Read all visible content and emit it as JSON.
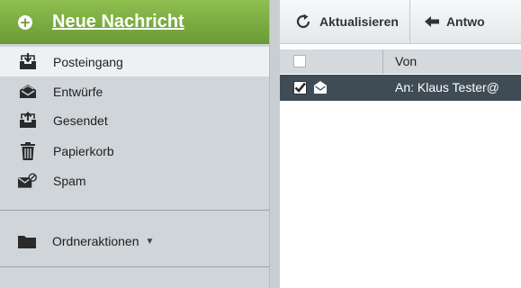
{
  "sidebar": {
    "new_message": "Neue Nachricht",
    "folders": [
      {
        "label": "Posteingang",
        "icon": "inbox-icon",
        "active": true
      },
      {
        "label": "Entwürfe",
        "icon": "drafts-icon"
      },
      {
        "label": "Gesendet",
        "icon": "sent-icon"
      },
      {
        "label": "Papierkorb",
        "icon": "trash-icon"
      },
      {
        "label": "Spam",
        "icon": "spam-icon"
      }
    ],
    "folder_actions": "Ordneraktionen"
  },
  "toolbar": {
    "refresh": "Aktualisieren",
    "reply": "Antwo"
  },
  "message_list": {
    "columns": {
      "from": "Von"
    },
    "rows": [
      {
        "to": "An: Klaus Tester@",
        "checked": true,
        "selected": true
      }
    ]
  },
  "colors": {
    "accent_green": "#7aab3f",
    "sidebar_bg": "#d0d5d9",
    "selected_row": "#3f4c56"
  }
}
